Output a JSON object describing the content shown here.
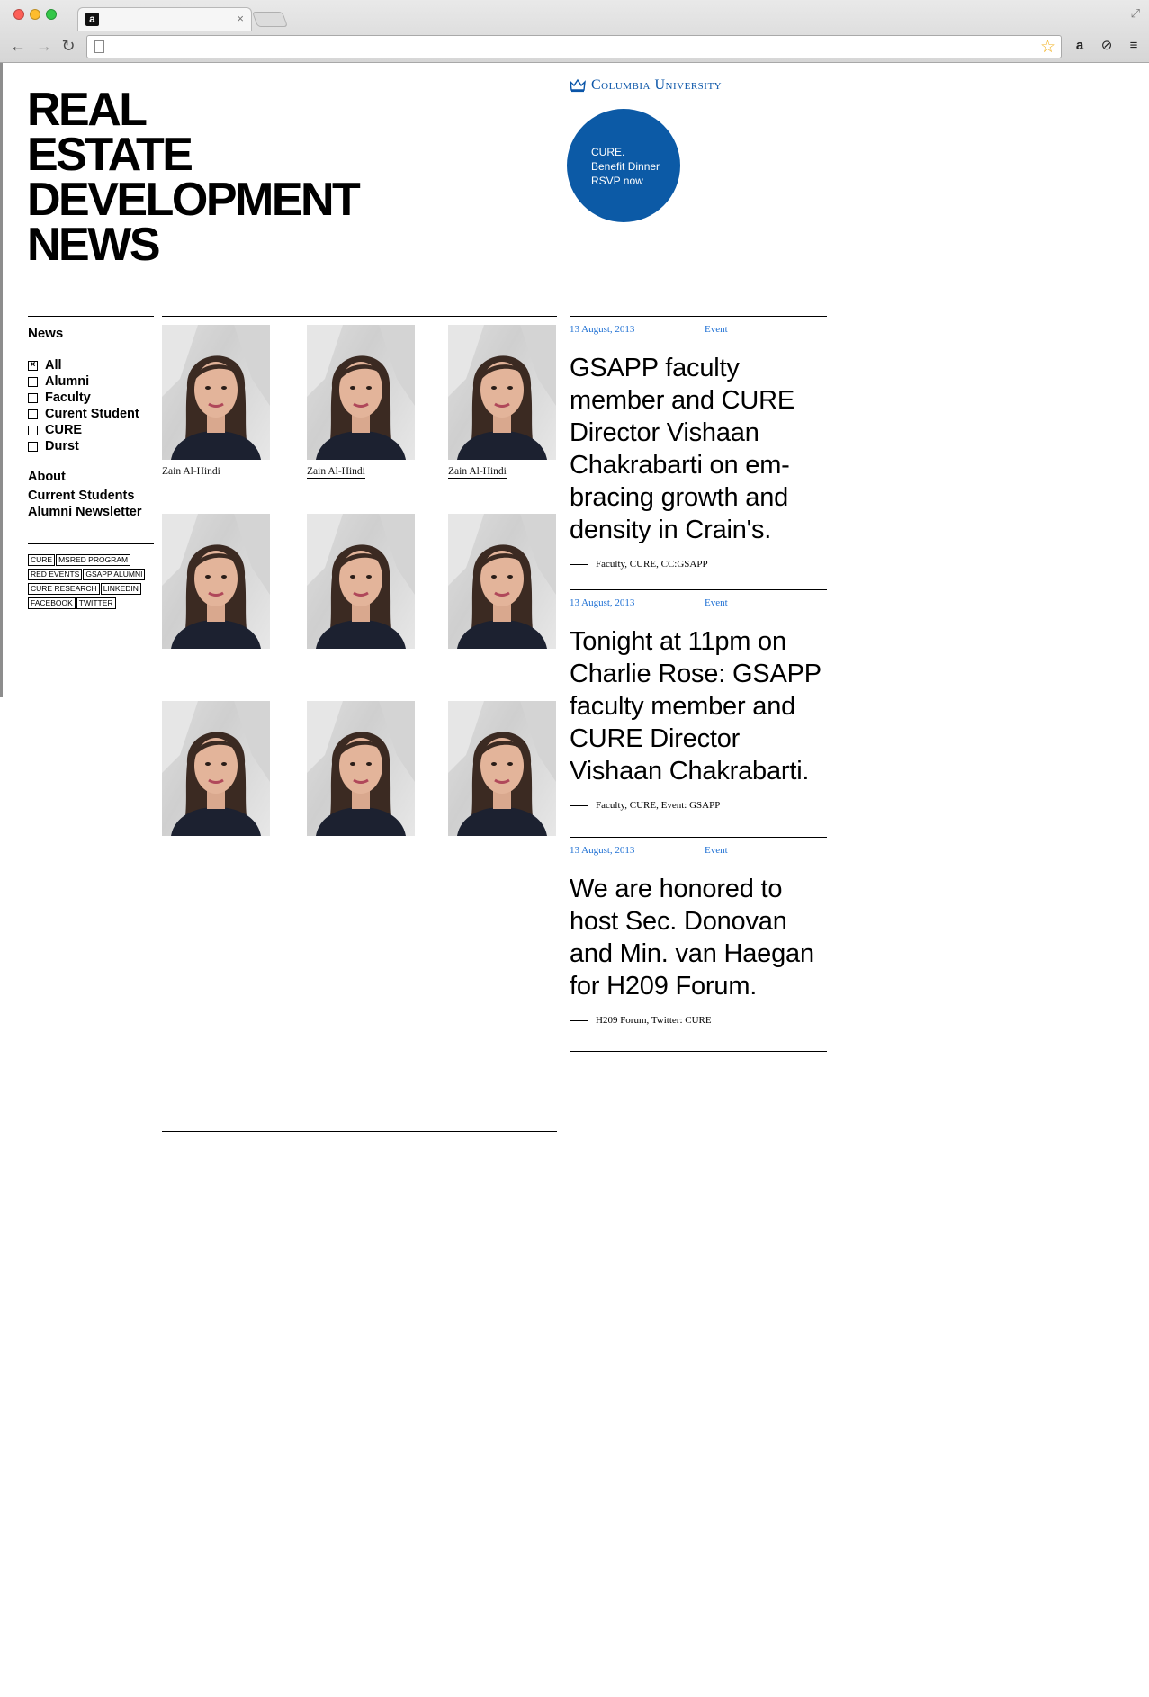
{
  "browser": {
    "tab_favicon": "a",
    "tab_close": "×",
    "icons": [
      "back-arrow-icon",
      "forward-arrow-icon",
      "reload-icon",
      "page-icon",
      "star-icon",
      "amazon-icon",
      "sync-icon",
      "menu-icon"
    ],
    "amazon_glyph": "a",
    "menu_glyph": "≡"
  },
  "header": {
    "title_lines": [
      "REAL",
      "ESTATE",
      "DEVELOPMENT",
      "NEWS"
    ],
    "university": "Columbia University",
    "promo": {
      "line1": "CURE.",
      "line2": "Benefit Dinner",
      "line3": "RSVP now"
    }
  },
  "colors": {
    "accent": "#0c5aa6",
    "link": "#1d6fd3"
  },
  "sidebar": {
    "heading": "News",
    "filters": [
      {
        "label": "All",
        "checked": true
      },
      {
        "label": "Alumni",
        "checked": false
      },
      {
        "label": "Faculty",
        "checked": false
      },
      {
        "label": "Curent Student",
        "checked": false
      },
      {
        "label": "CURE",
        "checked": false
      },
      {
        "label": "Durst",
        "checked": false
      }
    ],
    "links": [
      "About",
      "Current Students",
      "Alumni Newsletter"
    ],
    "tags": [
      "CURE",
      "MSRED PROGRAM",
      "RED EVENTS",
      "GSAPP ALUMNI",
      "CURE RESEARCH",
      "LINKEDIN",
      "FACEBOOK",
      "TWITTER"
    ]
  },
  "grid": {
    "captions": [
      "Zain Al-Hindi",
      "Zain Al-Hindi",
      "Zain Al-Hindi"
    ]
  },
  "news": [
    {
      "date": "13 August, 2013",
      "type": "Event",
      "headline": "GSAPP faculty member and CURE Director Vishaan Chakrabarti on em-bracing growth and density in Crain's.",
      "tags": "Faculty, CURE, CC:GSAPP"
    },
    {
      "date": "13 August, 2013",
      "type": "Event",
      "headline": "Tonight at 11pm on Charlie Rose: GSAPP faculty member and CURE Director Vishaan Chakrabarti.",
      "tags": "Faculty, CURE, Event: GSAPP"
    },
    {
      "date": "13 August, 2013",
      "type": "Event",
      "headline": "We are honored to host Sec. Donovan and Min. van Haegan for H209 Forum.",
      "tags": "H209 Forum, Twitter: CURE"
    }
  ]
}
